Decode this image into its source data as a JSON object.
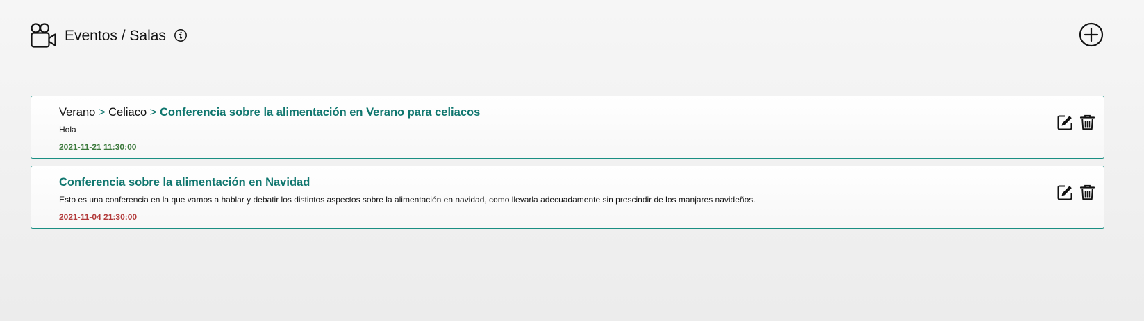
{
  "header": {
    "title": "Eventos / Salas",
    "page_icon": "video-camera-icon",
    "info_icon": "info-icon",
    "add_icon": "plus-circle-icon"
  },
  "events": [
    {
      "breadcrumb": [
        "Verano",
        "Celiaco"
      ],
      "separator": ">",
      "title": "Conferencia sobre la alimentación en Verano para celiacos",
      "description": "Hola",
      "date": "2021-11-21 11:30:00",
      "date_color": "#3d7a3d"
    },
    {
      "breadcrumb": [],
      "separator": ">",
      "title": "Conferencia sobre la alimentación en Navidad",
      "description": "Esto es una conferencia en la que vamos a hablar y debatir los distintos aspectos sobre la alimentación en navidad, como llevarla adecuadamente sin prescindir de los manjares navideños.",
      "date": "2021-11-04 21:30:00",
      "date_color": "#b23a3a"
    }
  ],
  "actions": {
    "edit_icon": "edit-icon",
    "delete_icon": "trash-icon"
  },
  "colors": {
    "accent": "#0f766e",
    "border": "#1a8f83"
  }
}
